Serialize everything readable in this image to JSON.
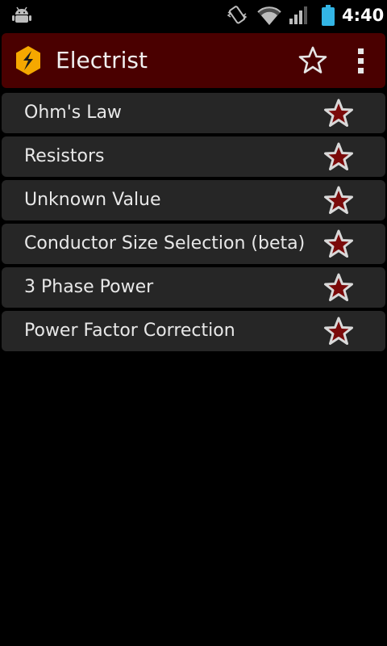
{
  "status_bar": {
    "time": "4:40",
    "icons": [
      "android-debug-icon",
      "vibrate-icon",
      "wifi-icon",
      "signal-icon",
      "battery-icon"
    ]
  },
  "action_bar": {
    "title": "Electrist",
    "icons": [
      "app-logo-icon",
      "star-outline-icon",
      "overflow-menu-icon"
    ],
    "background": "#4a0000"
  },
  "list": {
    "items": [
      {
        "label": "Ohm's Law"
      },
      {
        "label": "Resistors"
      },
      {
        "label": "Unknown Value"
      },
      {
        "label": "Conductor Size Selection (beta)"
      },
      {
        "label": "3 Phase Power"
      },
      {
        "label": "Power Factor Correction"
      }
    ],
    "item_icon": "favorite-star-icon",
    "star_fill": "#7a0a0a",
    "star_stroke": "#d9d9d9"
  }
}
